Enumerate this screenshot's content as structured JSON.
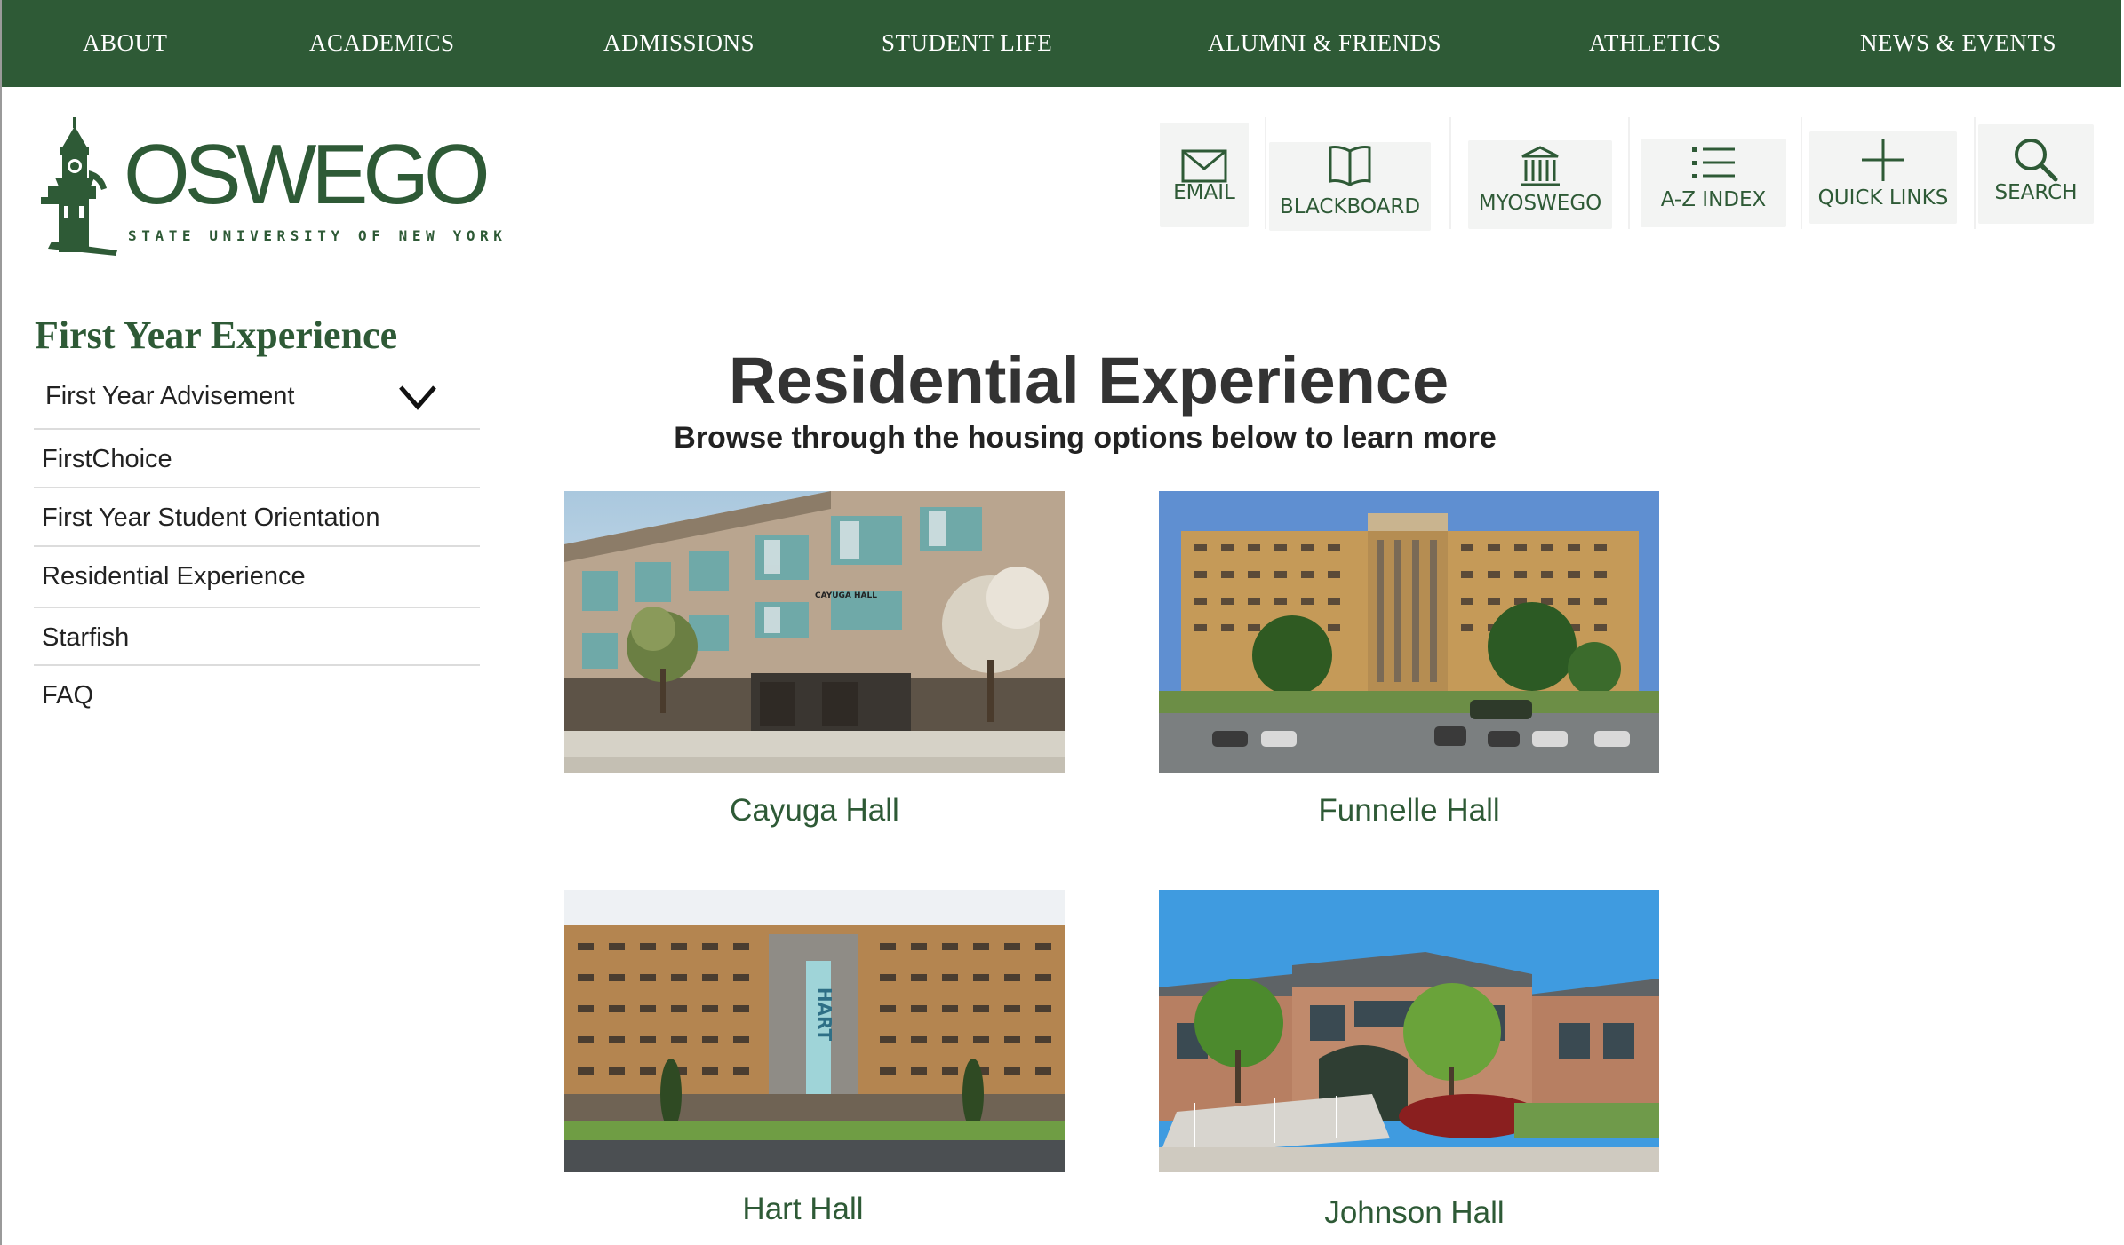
{
  "nav": {
    "items": [
      {
        "label": "ABOUT"
      },
      {
        "label": "ACADEMICS"
      },
      {
        "label": "ADMISSIONS"
      },
      {
        "label": "STUDENT LIFE"
      },
      {
        "label": "ALUMNI & FRIENDS"
      },
      {
        "label": "ATHLETICS"
      },
      {
        "label": "NEWS & EVENTS"
      }
    ]
  },
  "logo": {
    "wordmark": "OSWEGO",
    "tagline": "STATE UNIVERSITY OF NEW YORK"
  },
  "utility": {
    "items": [
      {
        "label": "EMAIL",
        "icon": "envelope-icon"
      },
      {
        "label": "BLACKBOARD",
        "icon": "book-icon"
      },
      {
        "label": "MYOSWEGO",
        "icon": "building-columns-icon"
      },
      {
        "label": "A-Z INDEX",
        "icon": "list-icon"
      },
      {
        "label": "QUICK LINKS",
        "icon": "plus-icon"
      },
      {
        "label": "SEARCH",
        "icon": "search-icon"
      }
    ]
  },
  "sidebar": {
    "title": "First Year Experience",
    "items": [
      {
        "label": "First Year Advisement",
        "expandable": true
      },
      {
        "label": "FirstChoice"
      },
      {
        "label": "First Year Student Orientation"
      },
      {
        "label": "Residential Experience"
      },
      {
        "label": "Starfish"
      },
      {
        "label": "FAQ"
      }
    ]
  },
  "main": {
    "title": "Residential Experience",
    "subtitle": "Browse through the housing options below to learn more",
    "halls": [
      {
        "name": "Cayuga Hall",
        "sign": "CAYUGA HALL"
      },
      {
        "name": "Funnelle Hall"
      },
      {
        "name": "Hart Hall",
        "banner": "HART"
      },
      {
        "name": "Johnson Hall"
      }
    ]
  },
  "colors": {
    "brand_green": "#2e5a36",
    "nav_text": "#ffffff",
    "utility_bg": "#f3f4f3"
  }
}
